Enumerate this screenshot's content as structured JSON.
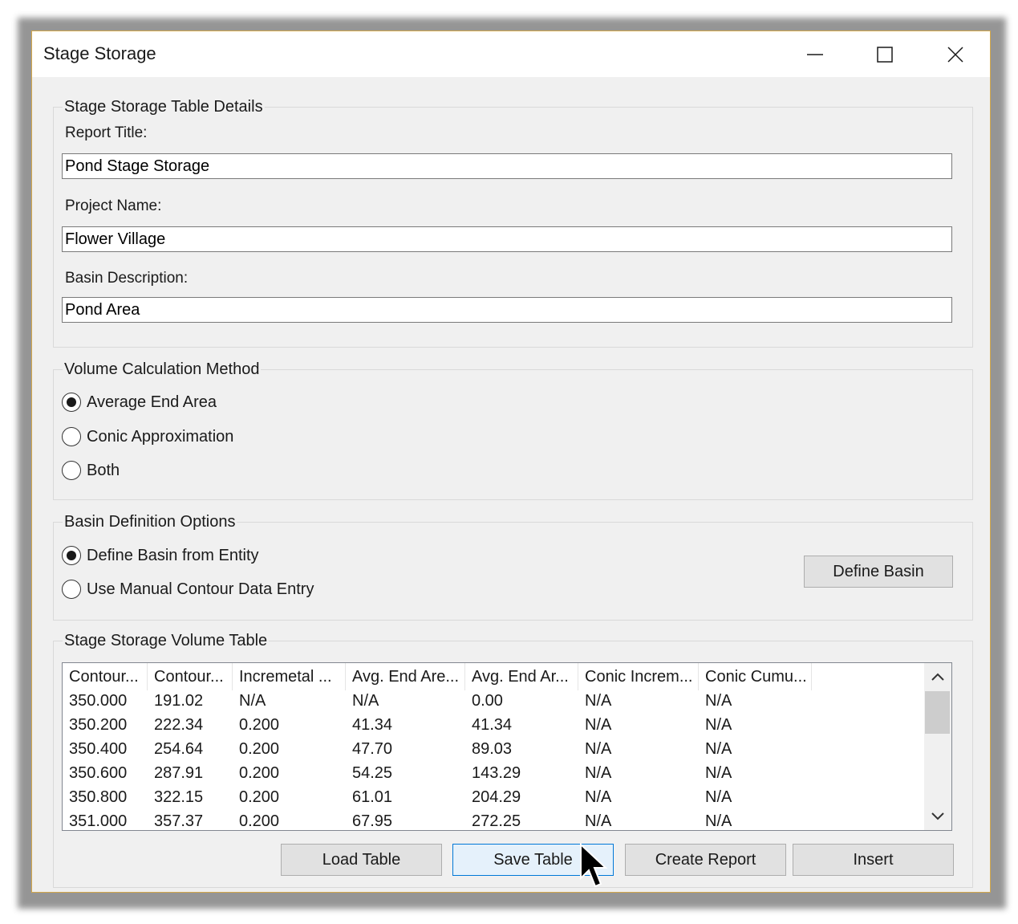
{
  "window": {
    "title": "Stage Storage"
  },
  "details": {
    "legend": "Stage Storage Table Details",
    "report_title_label": "Report Title:",
    "report_title_value": "Pond Stage Storage",
    "project_name_label": "Project Name:",
    "project_name_value": "Flower Village",
    "basin_description_label": "Basin Description:",
    "basin_description_value": "Pond Area"
  },
  "volume_method": {
    "legend": "Volume Calculation Method",
    "options": [
      "Average End Area",
      "Conic Approximation",
      "Both"
    ],
    "selected": "Average End Area"
  },
  "basin_options": {
    "legend": "Basin Definition Options",
    "options": [
      "Define Basin from Entity",
      "Use Manual Contour Data Entry"
    ],
    "selected": "Define Basin from Entity",
    "define_button": "Define Basin"
  },
  "volume_table": {
    "legend": "Stage Storage Volume Table",
    "headers": [
      "Contour...",
      "Contour...",
      "Incremetal ...",
      "Avg. End Are...",
      "Avg. End Ar...",
      "Conic Increm...",
      "Conic Cumu..."
    ],
    "rows": [
      [
        "350.000",
        "191.02",
        "N/A",
        "N/A",
        "0.00",
        "N/A",
        "N/A"
      ],
      [
        "350.200",
        "222.34",
        "0.200",
        "41.34",
        "41.34",
        "N/A",
        "N/A"
      ],
      [
        "350.400",
        "254.64",
        "0.200",
        "47.70",
        "89.03",
        "N/A",
        "N/A"
      ],
      [
        "350.600",
        "287.91",
        "0.200",
        "54.25",
        "143.29",
        "N/A",
        "N/A"
      ],
      [
        "350.800",
        "322.15",
        "0.200",
        "61.01",
        "204.29",
        "N/A",
        "N/A"
      ],
      [
        "351.000",
        "357.37",
        "0.200",
        "67.95",
        "272.25",
        "N/A",
        "N/A"
      ]
    ]
  },
  "buttons": {
    "load": "Load Table",
    "save": "Save Table",
    "report": "Create Report",
    "insert": "Insert"
  },
  "icons": {
    "minimize": "minimize-icon",
    "maximize": "maximize-icon",
    "close": "close-icon",
    "scroll_up": "chevron-up-icon",
    "scroll_down": "chevron-down-icon",
    "cursor": "mouse-pointer-icon"
  }
}
